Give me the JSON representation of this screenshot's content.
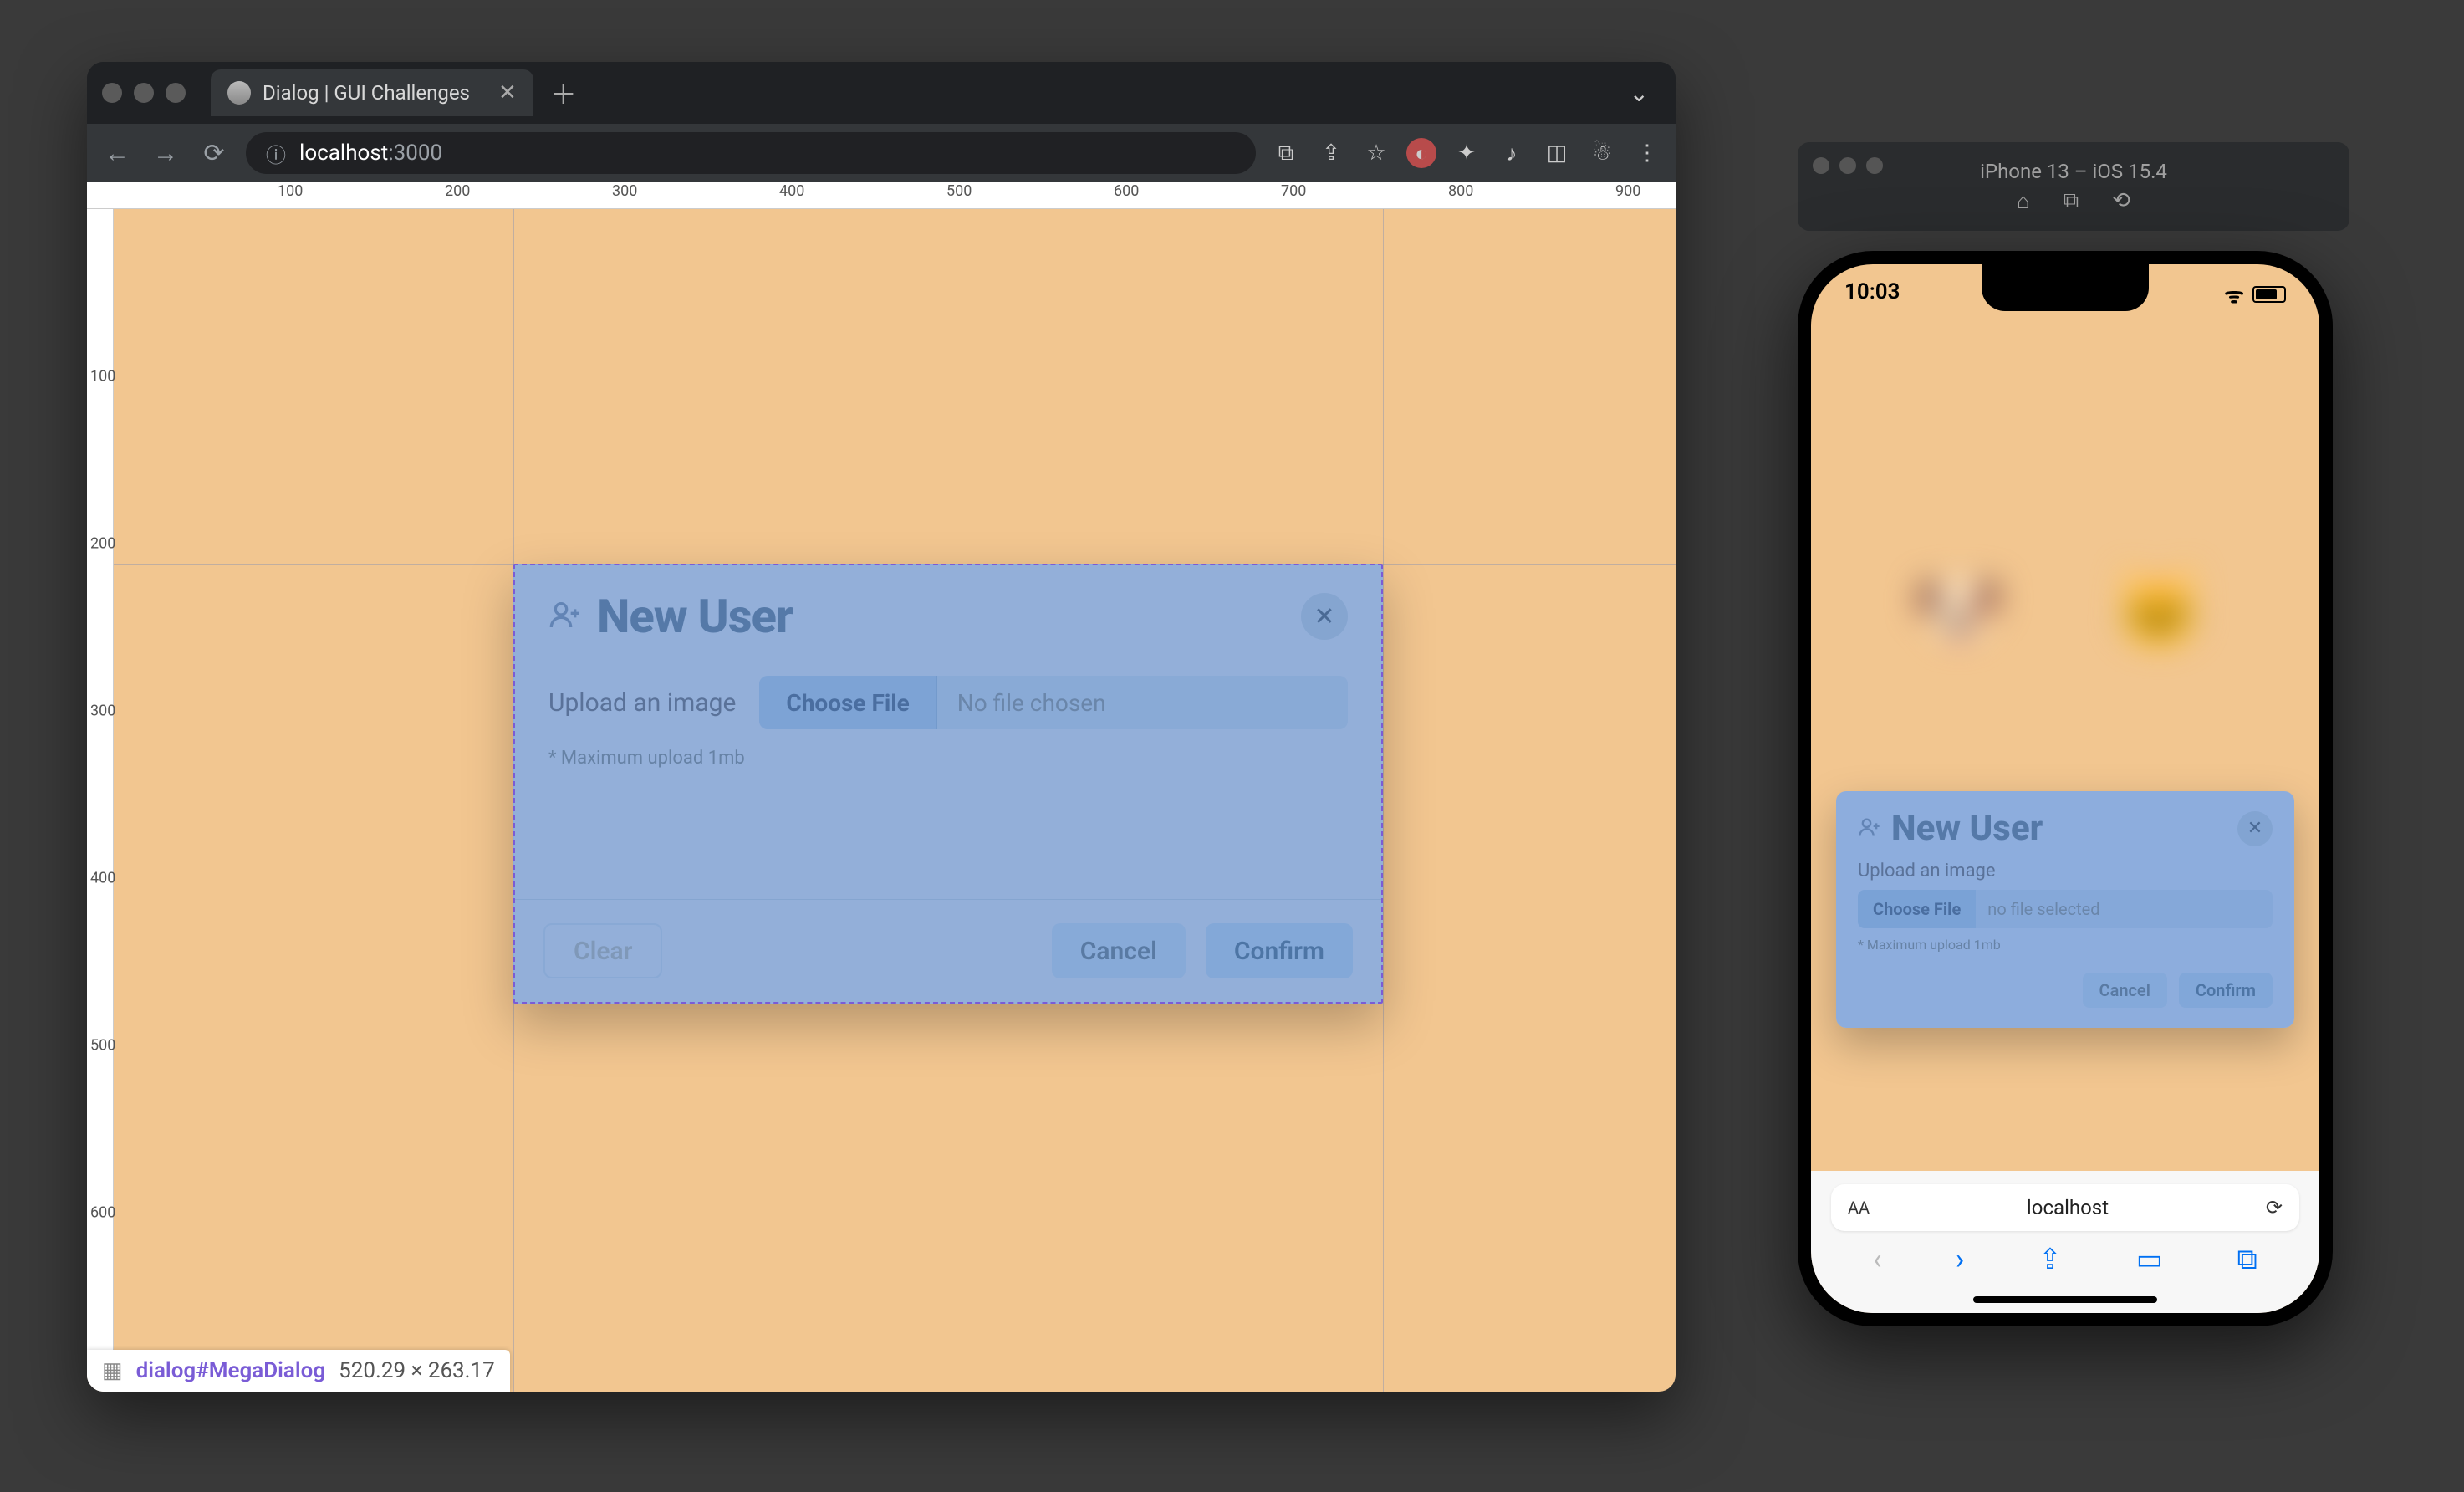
{
  "browser": {
    "tab_title": "Dialog | GUI Challenges",
    "url_host": "localhost",
    "url_port": ":3000"
  },
  "ruler": {
    "h": [
      "100",
      "200",
      "300",
      "400",
      "500",
      "600",
      "700",
      "800",
      "900"
    ],
    "v": [
      "100",
      "200",
      "300",
      "400",
      "500",
      "600"
    ]
  },
  "dialog": {
    "title": "New User",
    "upload_label": "Upload an image",
    "choose_file": "Choose File",
    "no_file": "No file chosen",
    "hint": "* Maximum upload 1mb",
    "clear": "Clear",
    "cancel": "Cancel",
    "confirm": "Confirm"
  },
  "devtools": {
    "selector": "dialog#MegaDialog",
    "dimensions": "520.29 × 263.17"
  },
  "simulator": {
    "title": "iPhone 13 – iOS 15.4",
    "time": "10:03",
    "safari_host": "localhost"
  },
  "mobile_dialog": {
    "title": "New User",
    "upload_label": "Upload an image",
    "choose_file": "Choose File",
    "no_file": "no file selected",
    "hint": "* Maximum upload 1mb",
    "cancel": "Cancel",
    "confirm": "Confirm"
  }
}
